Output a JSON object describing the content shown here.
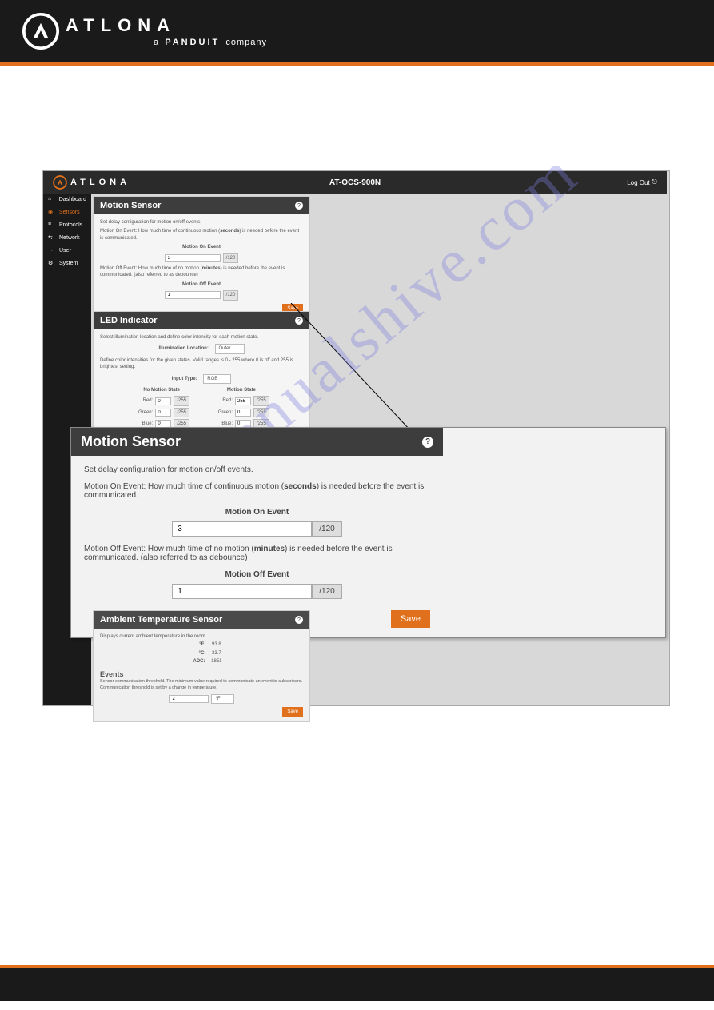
{
  "header": {
    "brand": "ATLONA",
    "subline_prefix": "a ",
    "subline_brand": "PANDUIT",
    "subline_suffix": " company"
  },
  "screenshot": {
    "brand": "ATLONA",
    "model": "AT-OCS-900N",
    "logout": "Log Out",
    "sidebar": [
      {
        "label": "Dashboard"
      },
      {
        "label": "Sensors"
      },
      {
        "label": "Protocols"
      },
      {
        "label": "Network"
      },
      {
        "label": "User"
      },
      {
        "label": "System"
      }
    ]
  },
  "motion_small": {
    "title": "Motion Sensor",
    "intro": "Set delay configuration for motion on/off events.",
    "on_desc_pre": "Motion On Event: How much time of continuous motion (",
    "on_desc_bold": "seconds",
    "on_desc_post": ") is needed before the event is communicated.",
    "on_label": "Motion On Event",
    "on_value": "3",
    "on_suffix": "/120",
    "off_desc_pre": "Motion Off Event: How much time of no motion (",
    "off_desc_bold": "minutes",
    "off_desc_post": ") is needed before the event is communicated. (also referred to as debounce)",
    "off_label": "Motion Off Event",
    "off_value": "1",
    "off_suffix": "/120",
    "save": "Save"
  },
  "led": {
    "title": "LED Indicator",
    "intro": "Select illumination location and define color intensity for each motion state.",
    "loc_label": "Illumination Location:",
    "loc_value": "Outer",
    "input_label": "Input Type:",
    "input_value": "RGB",
    "desc": "Define color intensities for the given states. Valid ranges is 0 - 255 where 0 is off and 255 is brightest setting.",
    "no_motion_title": "No Motion State",
    "motion_title": "Motion State",
    "rows": [
      {
        "label": "Red:",
        "no": "0",
        "mo": "255"
      },
      {
        "label": "Green:",
        "no": "0",
        "mo": "0"
      },
      {
        "label": "Blue:",
        "no": "0",
        "mo": "0"
      }
    ],
    "suffix": "/255"
  },
  "zoom": {
    "title": "Motion Sensor",
    "intro": "Set delay configuration for motion on/off events.",
    "on_desc_pre": "Motion On Event: How much time of continuous motion (",
    "on_desc_bold": "seconds",
    "on_desc_post": ") is needed before the event is communicated.",
    "on_label": "Motion On Event",
    "on_value": "3",
    "on_suffix": "/120",
    "off_desc_pre": "Motion Off Event: How much time of no motion (",
    "off_desc_bold": "minutes",
    "off_desc_post": ") is needed before the event is communicated. (also referred to as debounce)",
    "off_label": "Motion Off Event",
    "off_value": "1",
    "off_suffix": "/120",
    "save": "Save",
    "help": "?"
  },
  "ambient": {
    "title": "Ambient Temperature Sensor",
    "intro": "Displays current ambient temperature in the room.",
    "rows": [
      {
        "label": "°F:",
        "value": "93.8"
      },
      {
        "label": "°C:",
        "value": "33.7"
      },
      {
        "label": "ADC:",
        "value": "1851"
      }
    ],
    "events_title": "Events",
    "events_desc": "Sensor communication threshold. The minimum value required to communicate an event to subscribers. Communication threshold is set by a change in temperature.",
    "thresh_value": "2",
    "thresh_unit": "°F",
    "save": "Save"
  },
  "watermark": "manualshive.com"
}
